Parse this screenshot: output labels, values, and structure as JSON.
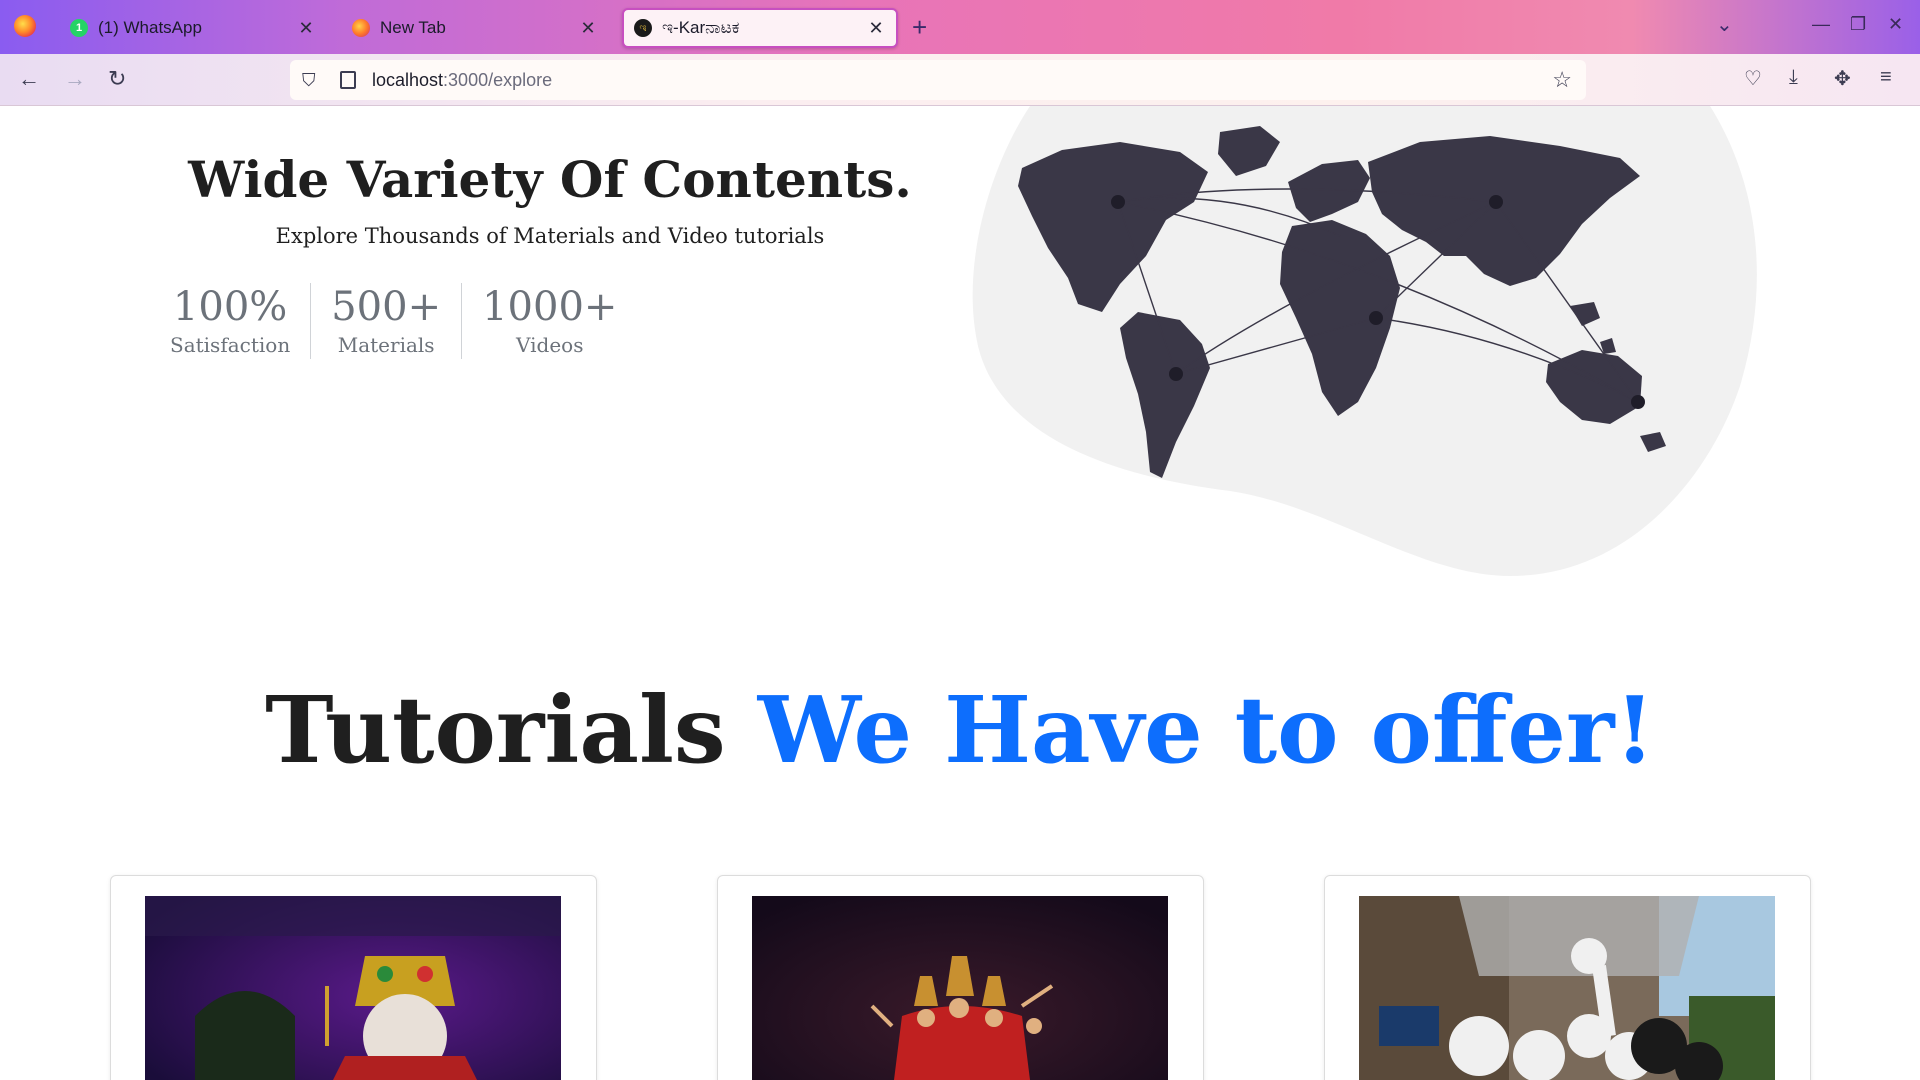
{
  "browser": {
    "tabs": [
      {
        "title": "(1) WhatsApp",
        "badge": "1",
        "active": false
      },
      {
        "title": "New Tab",
        "active": false
      },
      {
        "title": "ಇ-Karನಾಟಕ",
        "active": true
      }
    ],
    "url_host": "localhost",
    "url_path": ":3000/explore",
    "gradient_colors": [
      "#8a5cf0",
      "#e874b8",
      "#f07aa8"
    ]
  },
  "hero": {
    "title": "Wide Variety Of Contents.",
    "subtitle": "Explore Thousands of Materials and Video tutorials",
    "stats": [
      {
        "value": "100%",
        "label": "Satisfaction"
      },
      {
        "value": "500+",
        "label": "Materials"
      },
      {
        "value": "1000+",
        "label": "Videos"
      }
    ]
  },
  "tutorials": {
    "heading_part1": "Tutorials ",
    "heading_accent": "We Have to offer!",
    "accent_color": "#0d6efd"
  },
  "cards": [
    {
      "image": "yakshagana-performers"
    },
    {
      "image": "bharatanatyam-dancers"
    },
    {
      "image": "folk-costume-procession"
    }
  ]
}
